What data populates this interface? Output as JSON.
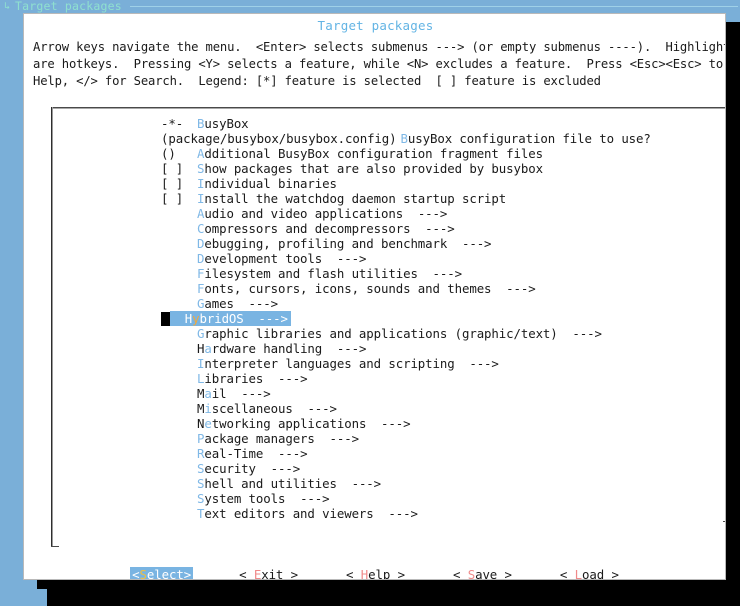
{
  "topbar": {
    "arrow_icon": "breadcrumb-arrow-icon",
    "arrow_glyph": "↳",
    "breadcrumb": "Target packages"
  },
  "dialog": {
    "title": "Target packages",
    "help_lines": [
      "Arrow keys navigate the menu.  <Enter> selects submenus ---> (or empty submenus ----).  Highlighted letters",
      "are hotkeys.  Pressing <Y> selects a feature, while <N> excludes a feature.  Press <Esc><Esc> to exit, <?> for",
      "Help, </> for Search.  Legend: [*] feature is selected  [ ] feature is excluded"
    ]
  },
  "menu": {
    "items": [
      {
        "prefix": "-*-",
        "hot": "B",
        "rest": "usyBox",
        "arrow": "",
        "selected": false
      },
      {
        "prefix": "(package/busybox/busybox.config)",
        "wide": true,
        "hot": "B",
        "rest": "usyBox configuration file to use?",
        "arrow": "",
        "selected": false
      },
      {
        "prefix": "()",
        "hot": "A",
        "rest": "dditional BusyBox configuration fragment files",
        "arrow": "",
        "selected": false
      },
      {
        "prefix": "[ ]",
        "hot": "S",
        "rest": "how packages that are also provided by busybox",
        "arrow": "",
        "selected": false
      },
      {
        "prefix": "[ ]",
        "hot": "I",
        "rest": "ndividual binaries",
        "arrow": "",
        "selected": false
      },
      {
        "prefix": "[ ]",
        "hot": "I",
        "rest": "nstall the watchdog daemon startup script",
        "arrow": "",
        "selected": false
      },
      {
        "prefix": "",
        "hot": "A",
        "rest": "udio and video applications",
        "arrow": "  --->",
        "selected": false
      },
      {
        "prefix": "",
        "hot": "C",
        "rest": "ompressors and decompressors",
        "arrow": "  --->",
        "selected": false
      },
      {
        "prefix": "",
        "hot": "D",
        "rest": "ebugging, profiling and benchmark",
        "arrow": "  --->",
        "selected": false
      },
      {
        "prefix": "",
        "hot": "D",
        "rest": "evelopment tools",
        "arrow": "  --->",
        "selected": false
      },
      {
        "prefix": "",
        "hot": "F",
        "rest": "ilesystem and flash utilities",
        "arrow": "  --->",
        "selected": false
      },
      {
        "prefix": "",
        "hot": "F",
        "rest": "onts, cursors, icons, sounds and themes",
        "arrow": "  --->",
        "selected": false
      },
      {
        "prefix": "",
        "hot": "G",
        "rest": "ames",
        "arrow": "  --->",
        "selected": false
      },
      {
        "prefix": "",
        "pre_hot": "H",
        "hot": "y",
        "rest": "bridOS",
        "arrow": "  --->",
        "selected": true
      },
      {
        "prefix": "",
        "hot": "G",
        "rest": "raphic libraries and applications (graphic/text)",
        "arrow": "  --->",
        "selected": false
      },
      {
        "prefix": "",
        "pre_hot": "H",
        "hot": "a",
        "rest": "rdware handling",
        "arrow": "  --->",
        "selected": false
      },
      {
        "prefix": "",
        "hot": "I",
        "rest": "nterpreter languages and scripting",
        "arrow": "  --->",
        "selected": false
      },
      {
        "prefix": "",
        "hot": "L",
        "rest": "ibraries",
        "arrow": "  --->",
        "selected": false
      },
      {
        "prefix": "",
        "pre_hot": "M",
        "hot": "a",
        "rest": "il",
        "arrow": "  --->",
        "selected": false
      },
      {
        "prefix": "",
        "pre_hot": "M",
        "hot": "i",
        "rest": "scellaneous",
        "arrow": "  --->",
        "selected": false
      },
      {
        "prefix": "",
        "pre_hot": "N",
        "hot": "e",
        "rest": "tworking applications",
        "arrow": "  --->",
        "selected": false
      },
      {
        "prefix": "",
        "hot": "P",
        "rest": "ackage managers",
        "arrow": "  --->",
        "selected": false
      },
      {
        "prefix": "",
        "hot": "R",
        "rest": "eal-Time",
        "arrow": "  --->",
        "selected": false
      },
      {
        "prefix": "",
        "hot": "S",
        "rest": "ecurity",
        "arrow": "  --->",
        "selected": false
      },
      {
        "prefix": "",
        "hot": "S",
        "rest": "hell and utilities",
        "arrow": "  --->",
        "selected": false
      },
      {
        "prefix": "",
        "hot": "S",
        "rest": "ystem tools",
        "arrow": "  --->",
        "selected": false
      },
      {
        "prefix": "",
        "hot": "T",
        "rest": "ext editors and viewers",
        "arrow": "  --->",
        "selected": false
      }
    ]
  },
  "buttons": [
    {
      "open": "<",
      "hot": "S",
      "rest": "elect",
      "close": ">",
      "active": true
    },
    {
      "open": "< ",
      "hot": "E",
      "rest": "xit",
      "close": " >",
      "active": false
    },
    {
      "open": "< ",
      "hot": "H",
      "rest": "elp",
      "close": " >",
      "active": false
    },
    {
      "open": "< ",
      "hot": "S",
      "rest": "ave",
      "close": " >",
      "active": false
    },
    {
      "open": "< ",
      "hot": "L",
      "rest": "oad",
      "close": " >",
      "active": false
    }
  ],
  "colors": {
    "terminal_background": "#7aafd8",
    "dialog_background": "#ffffff",
    "title_accent": "#63b4e4",
    "hotkey_blue": "#7fb8e6",
    "hotkey_selected": "#f2a93b",
    "selection_background": "#79b4e2",
    "button_hotkey": "#f08a8a",
    "button_active_hotkey": "#f0c040",
    "breadcrumb_text": "#8fe0cf",
    "shadow": "#000000"
  }
}
